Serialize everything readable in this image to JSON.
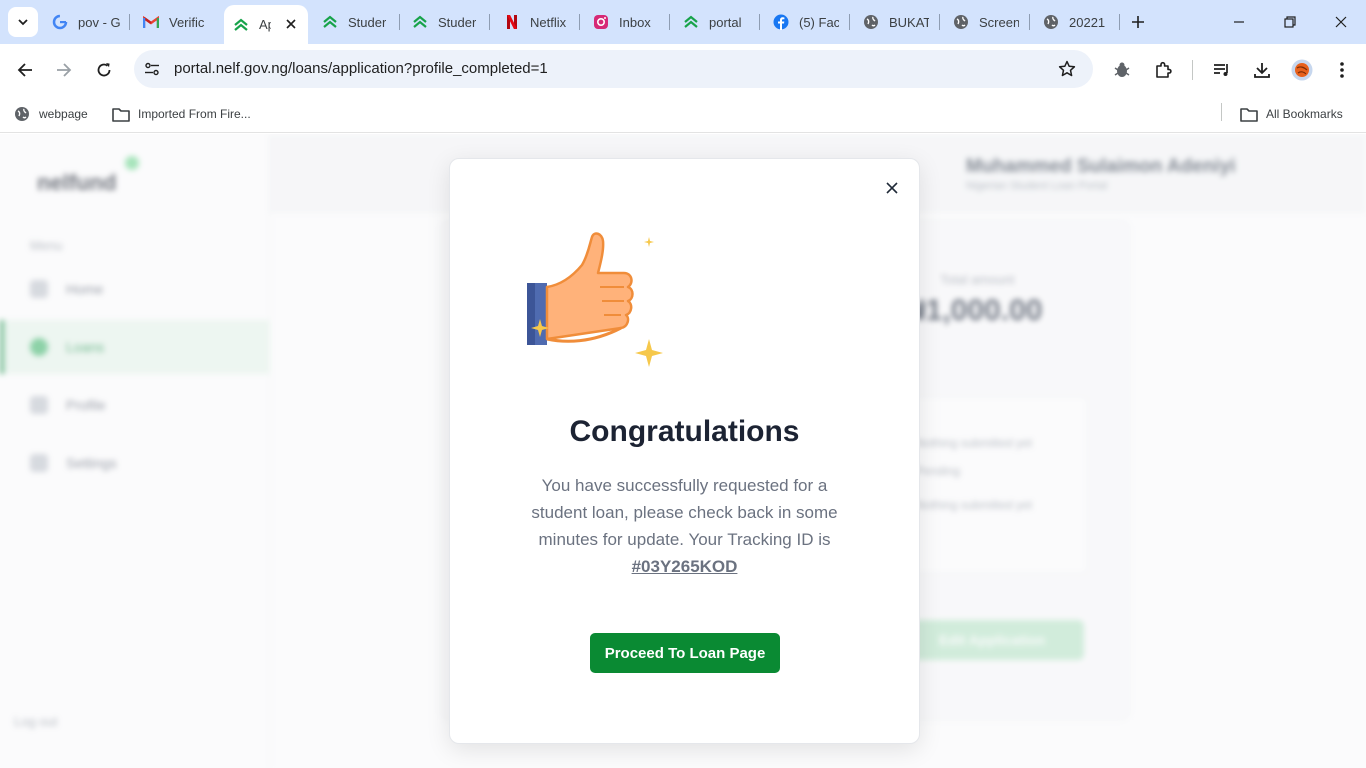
{
  "browser": {
    "tabs": [
      {
        "title": "pov - G",
        "icon": "google-icon"
      },
      {
        "title": "Verific",
        "icon": "gmail-icon"
      },
      {
        "title": "Ap",
        "icon": "nelf-icon",
        "active": true
      },
      {
        "title": "Studer",
        "icon": "nelf-icon"
      },
      {
        "title": "Studer",
        "icon": "nelf-icon"
      },
      {
        "title": "Netflix",
        "icon": "netflix-icon"
      },
      {
        "title": "Inbox",
        "icon": "instagram-icon"
      },
      {
        "title": "portal",
        "icon": "nelf-icon"
      },
      {
        "title": "(5) Fac",
        "icon": "facebook-icon"
      },
      {
        "title": "BUKAT",
        "icon": "globe-icon"
      },
      {
        "title": "Screen",
        "icon": "globe-icon"
      },
      {
        "title": "20221",
        "icon": "globe-icon"
      }
    ],
    "url": "portal.nelf.gov.ng/loans/application?profile_completed=1",
    "bookmarks": [
      {
        "label": "webpage",
        "icon": "globe-icon"
      },
      {
        "label": "Imported From Fire...",
        "icon": "folder-icon"
      }
    ],
    "all_bookmarks_label": "All Bookmarks"
  },
  "page": {
    "logo": "nelfund",
    "sidebar": {
      "menu_label": "Menu",
      "items": [
        {
          "label": "Home"
        },
        {
          "label": "Loans",
          "active": true
        },
        {
          "label": "Profile"
        },
        {
          "label": "Settings"
        }
      ],
      "logout_label": "Log out"
    },
    "header": {
      "user_name": "Muhammed Sulaimon Adeniyi",
      "user_sub": "Nigerian Student Loan Portal"
    },
    "loan": {
      "amount_label": "Total amount",
      "amount": "₦1,000.00",
      "info_lines": [
        "Nothing submitted yet",
        "Pending",
        "Nothing submitted yet"
      ],
      "button_label": "Edit Application"
    }
  },
  "modal": {
    "title": "Congratulations",
    "message": "You have successfully requested for a student loan, please check back in some minutes for update. Your Tracking ID is",
    "tracking_id": "#03Y265KOD",
    "button_label": "Proceed To Loan Page"
  },
  "colors": {
    "tabstrip": "#d3e3fd",
    "primary_button": "#0a8a33",
    "title_text": "#1c2333",
    "body_text": "#6b7280"
  }
}
